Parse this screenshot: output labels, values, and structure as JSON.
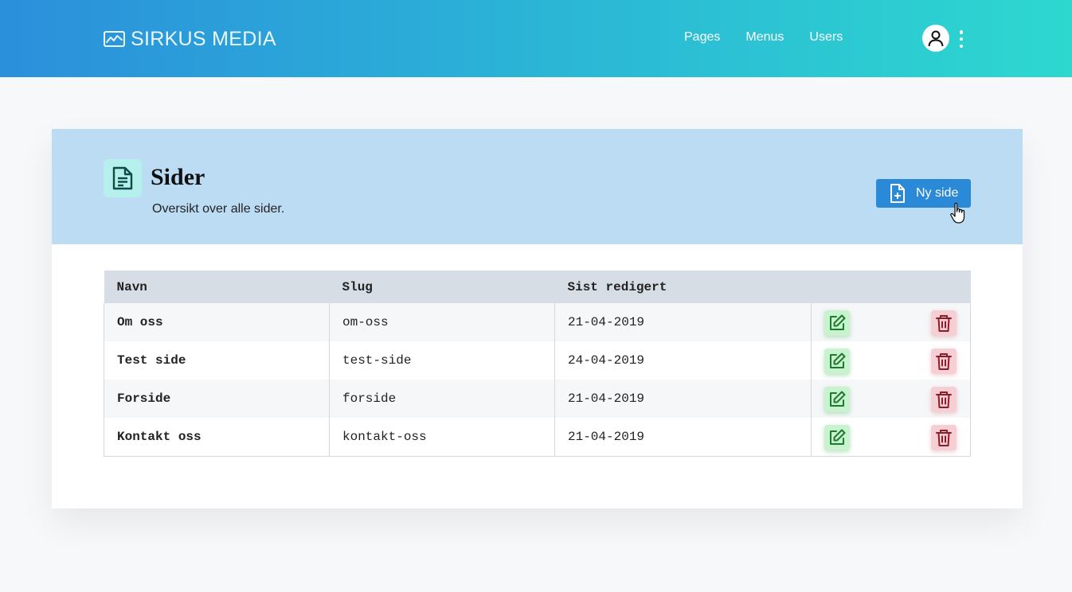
{
  "brand": {
    "name": "SIRKUS MEDIA",
    "icon": "chart-line-icon"
  },
  "nav": {
    "items": [
      {
        "label": "Pages"
      },
      {
        "label": "Menus"
      },
      {
        "label": "Users"
      }
    ]
  },
  "user_menu": {
    "avatar_icon": "user-icon",
    "more_icon": "more-vertical-icon"
  },
  "colors": {
    "header_gradient_start": "#2b8fdb",
    "header_gradient_end": "#2dd8cf",
    "card_header_bg": "#bcdcf4",
    "primary_button": "#2b8ad8",
    "edit_button_bg": "#c9f2cf",
    "delete_button_bg": "#f5cfd3"
  },
  "page": {
    "title": "Sider",
    "subtitle": "Oversikt over alle sider.",
    "icon": "document-icon",
    "new_button_label": "Ny side",
    "new_button_icon": "file-plus-icon"
  },
  "table": {
    "headers": {
      "name": "Navn",
      "slug": "Slug",
      "edited": "Sist redigert"
    },
    "rows": [
      {
        "name": "Om oss",
        "slug": "om-oss",
        "edited": "21-04-2019"
      },
      {
        "name": "Test side",
        "slug": "test-side",
        "edited": "24-04-2019"
      },
      {
        "name": "Forside",
        "slug": "forside",
        "edited": "21-04-2019"
      },
      {
        "name": "Kontakt oss",
        "slug": "kontakt-oss",
        "edited": "21-04-2019"
      }
    ],
    "edit_icon": "edit-icon",
    "delete_icon": "trash-icon"
  }
}
